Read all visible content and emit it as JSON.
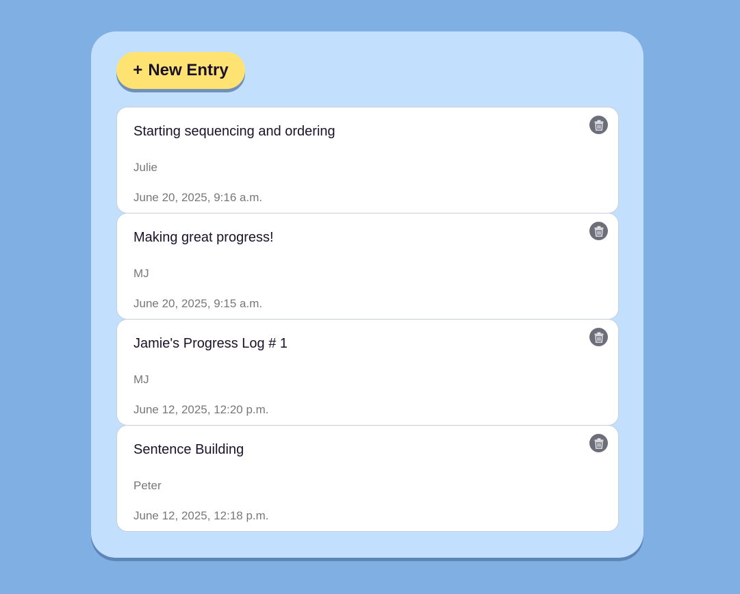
{
  "toolbar": {
    "new_entry_icon": "+",
    "new_entry_label": "New Entry"
  },
  "entries": [
    {
      "title": "Starting sequencing and ordering",
      "author": "Julie",
      "date": "June 20, 2025, 9:16 a.m.",
      "delete_icon": "trash-icon"
    },
    {
      "title": "Making great progress!",
      "author": "MJ",
      "date": "June 20, 2025, 9:15 a.m.",
      "delete_icon": "trash-icon"
    },
    {
      "title": "Jamie's Progress Log # 1",
      "author": "MJ",
      "date": "June 12, 2025, 12:20 p.m.",
      "delete_icon": "trash-icon"
    },
    {
      "title": "Sentence Building",
      "author": "Peter",
      "date": "June 12, 2025, 12:18 p.m.",
      "delete_icon": "trash-icon"
    }
  ],
  "colors": {
    "background": "#80afe3",
    "panel": "#c2dffd",
    "accent_button": "#ffe372",
    "card": "#ffffff",
    "delete_button": "#6c6f7a",
    "title_text": "#1a1028",
    "meta_text": "#777777"
  }
}
